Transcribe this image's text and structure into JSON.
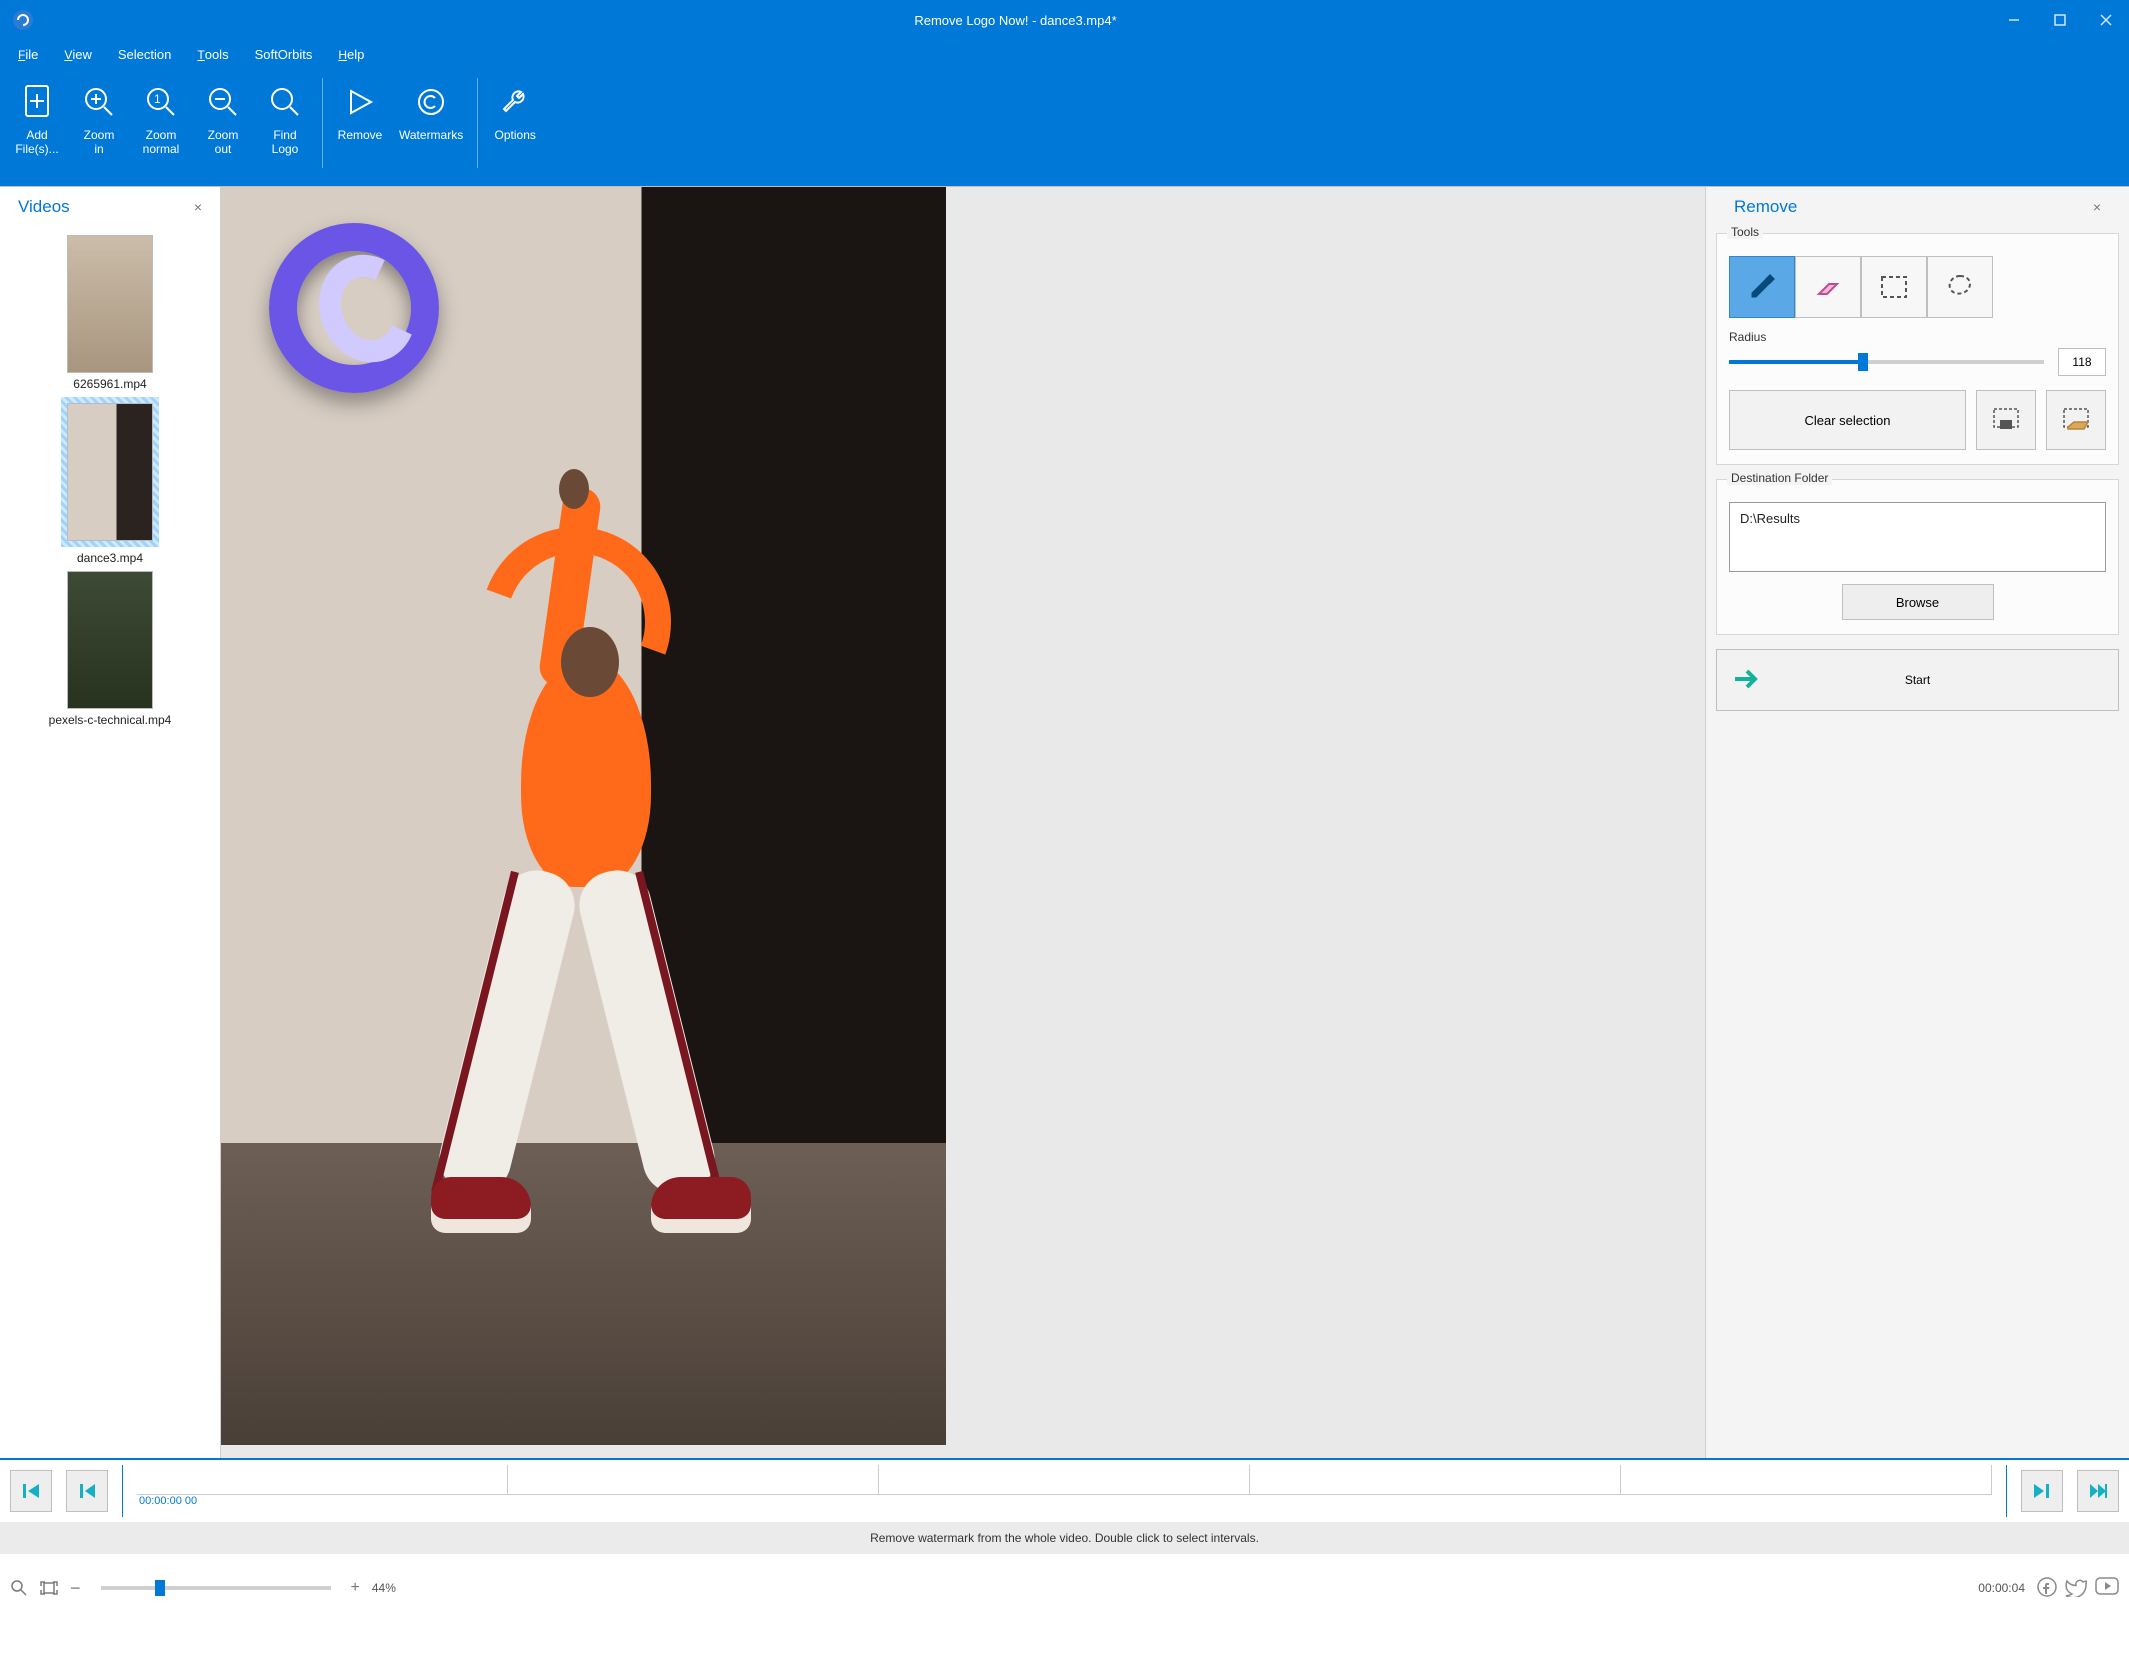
{
  "window": {
    "title": "Remove Logo Now! - dance3.mp4*"
  },
  "menu": {
    "file": "File",
    "view": "View",
    "selection": "Selection",
    "tools": "Tools",
    "softorbits": "SoftOrbits",
    "help": "Help"
  },
  "toolbar": {
    "add_files": "Add\nFile(s)...",
    "zoom_in": "Zoom\nin",
    "zoom_normal": "Zoom\nnormal",
    "zoom_out": "Zoom\nout",
    "find_logo": "Find\nLogo",
    "remove": "Remove",
    "watermarks": "Watermarks",
    "options": "Options"
  },
  "videos_panel": {
    "title": "Videos",
    "items": [
      {
        "name": "6265961.mp4"
      },
      {
        "name": "dance3.mp4"
      },
      {
        "name": "pexels-c-technical.mp4"
      }
    ]
  },
  "remove_panel": {
    "title": "Remove",
    "tools_legend": "Tools",
    "radius_label": "Radius",
    "radius_value": "118",
    "radius_percent": 41,
    "clear_selection": "Clear selection",
    "dest_legend": "Destination Folder",
    "dest_path": "D:\\Results",
    "browse": "Browse",
    "start": "Start"
  },
  "timeline": {
    "current": "00:00:00 00",
    "hint": "Remove watermark from the whole video. Double click to select intervals."
  },
  "status": {
    "zoom_percent": "44%",
    "duration": "00:00:04"
  }
}
